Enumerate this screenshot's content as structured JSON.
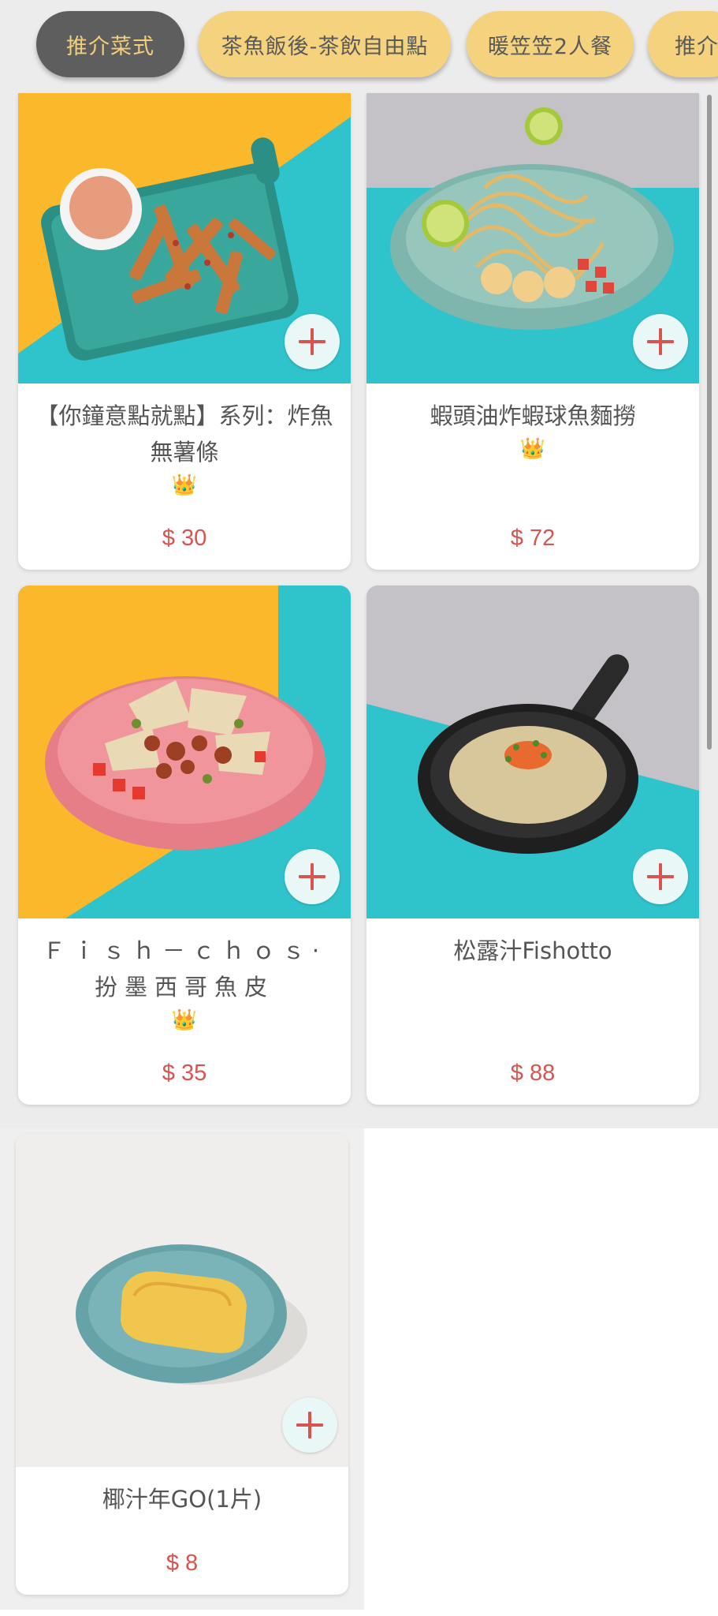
{
  "tabs": [
    {
      "label": "推介菜式",
      "active": true
    },
    {
      "label": "茶魚飯後-茶飲自由點",
      "active": false
    },
    {
      "label": "暖笠笠2人餐",
      "active": false
    },
    {
      "label": "推介",
      "active": false
    }
  ],
  "dishes": [
    {
      "name": "【你鐘意點就點】系列：炸魚無薯條",
      "badge": "👑",
      "price": "$ 30",
      "photo": "fish-and-fries-icon"
    },
    {
      "name": "蝦頭油炸蝦球魚麵撈",
      "badge": "👑",
      "price": "$ 72",
      "photo": "shrimp-noodle-icon"
    },
    {
      "name": "Ｆｉｓｈ－ｃｈｏｓ·扮墨西哥魚皮",
      "badge": "👑",
      "price": "$ 35",
      "photo": "fish-skin-nachos-icon"
    },
    {
      "name": "松露汁Fishotto",
      "badge": "",
      "price": "$ 88",
      "photo": "risotto-skillet-icon"
    },
    {
      "name": "椰汁年GO(1片)",
      "badge": "",
      "price": "$ 8",
      "photo": "coconut-cake-icon"
    }
  ],
  "add_button_icon": "plus-icon",
  "colors": {
    "active_tab_bg": "#5e5e5e",
    "active_tab_text": "#f2d07a",
    "inactive_tab_bg": "#f4d27e",
    "price": "#d9534f",
    "add_button_bg": "#e9f8f6"
  }
}
